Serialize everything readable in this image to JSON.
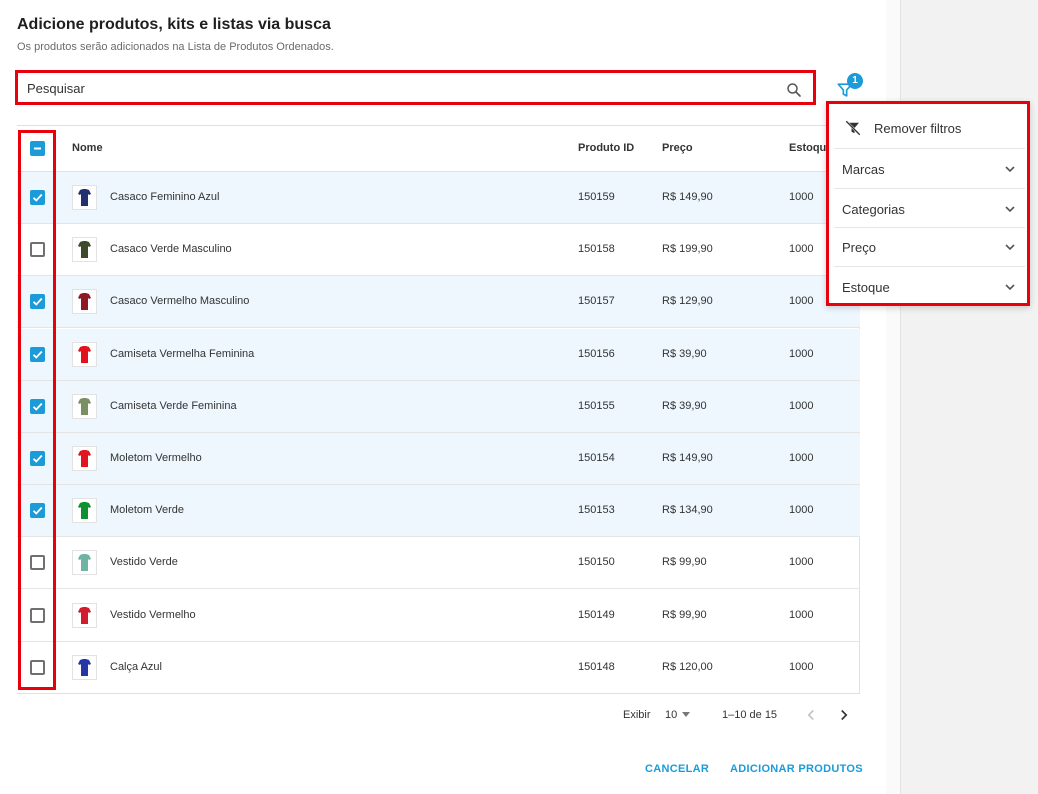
{
  "header": {
    "title": "Adicione produtos, kits e listas via busca",
    "subtitle": "Os produtos serão adicionados na Lista de Produtos Ordenados."
  },
  "search": {
    "placeholder": "Pesquisar",
    "value": ""
  },
  "filter": {
    "badge_count": "1",
    "icon": "filter-icon"
  },
  "columns": {
    "nome": "Nome",
    "produto_id": "Produto ID",
    "preco": "Preço",
    "estoque": "Estoque"
  },
  "header_checkbox": {
    "state": "indeterminate"
  },
  "rows": [
    {
      "nome": "Casaco Feminino Azul",
      "id": "150159",
      "preco": "R$ 149,90",
      "estoque": "1000",
      "checked": true,
      "thumb_color": "#23306f"
    },
    {
      "nome": "Casaco Verde Masculino",
      "id": "150158",
      "preco": "R$ 199,90",
      "estoque": "1000",
      "checked": false,
      "thumb_color": "#3e4a2c"
    },
    {
      "nome": "Casaco Vermelho Masculino",
      "id": "150157",
      "preco": "R$ 129,90",
      "estoque": "1000",
      "checked": true,
      "thumb_color": "#8c1b26"
    },
    {
      "nome": "Camiseta Vermelha Feminina",
      "id": "150156",
      "preco": "R$ 39,90",
      "estoque": "1000",
      "checked": true,
      "thumb_color": "#e3111d"
    },
    {
      "nome": "Camiseta Verde Feminina",
      "id": "150155",
      "preco": "R$ 39,90",
      "estoque": "1000",
      "checked": true,
      "thumb_color": "#7a8f62"
    },
    {
      "nome": "Moletom Vermelho",
      "id": "150154",
      "preco": "R$ 149,90",
      "estoque": "1000",
      "checked": true,
      "thumb_color": "#e2141f"
    },
    {
      "nome": "Moletom Verde",
      "id": "150153",
      "preco": "R$ 134,90",
      "estoque": "1000",
      "checked": true,
      "thumb_color": "#0f9131"
    },
    {
      "nome": "Vestido Verde",
      "id": "150150",
      "preco": "R$ 99,90",
      "estoque": "1000",
      "checked": false,
      "thumb_color": "#6fb3a4"
    },
    {
      "nome": "Vestido Vermelho",
      "id": "150149",
      "preco": "R$ 99,90",
      "estoque": "1000",
      "checked": false,
      "thumb_color": "#d21c2c"
    },
    {
      "nome": "Calça Azul",
      "id": "150148",
      "preco": "R$ 120,00",
      "estoque": "1000",
      "checked": false,
      "thumb_color": "#2338a6"
    }
  ],
  "filter_menu": {
    "remove_label": "Remover filtros",
    "items": [
      {
        "label": "Marcas"
      },
      {
        "label": "Categorias"
      },
      {
        "label": "Preço"
      },
      {
        "label": "Estoque"
      }
    ]
  },
  "pagination": {
    "show_label": "Exibir",
    "page_size": "10",
    "range": "1–10 de 15"
  },
  "actions": {
    "cancel": "CANCELAR",
    "add": "ADICIONAR PRODUTOS"
  },
  "colors": {
    "accent": "#1b9bd8",
    "highlight": "#e8000b",
    "selected_row": "#edf7fd"
  }
}
